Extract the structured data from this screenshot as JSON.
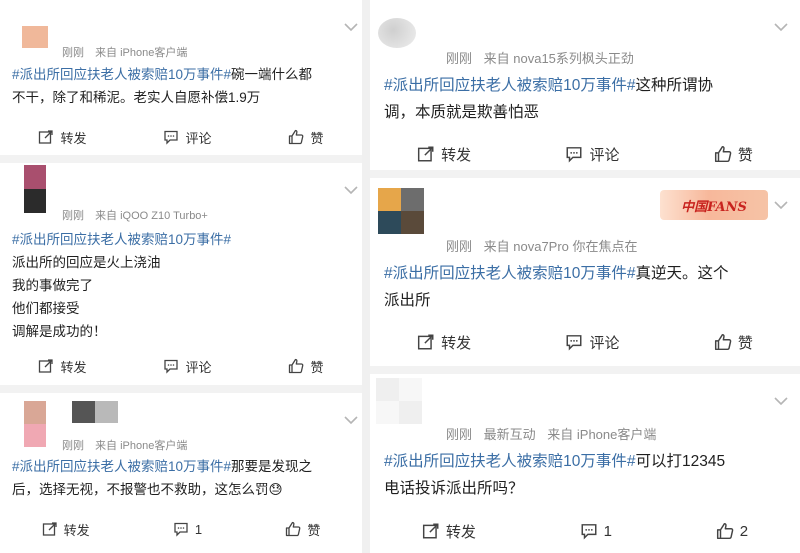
{
  "left": {
    "posts": [
      {
        "time": "刚刚",
        "source": "来自 iPhone客户端",
        "lines": [
          {
            "tag": "#派出所回应扶老人被索赔10万事件#",
            "text": "碗一端什么都"
          },
          {
            "tag": "",
            "text": "不干，除了和稀泥。老实人自愿补偿1.9万"
          }
        ],
        "actions": {
          "repost": "转发",
          "comment": "评论",
          "like": "赞"
        }
      },
      {
        "time": "刚刚",
        "source": "来自 iQOO Z10 Turbo+",
        "lines": [
          {
            "tag": "#派出所回应扶老人被索赔10万事件#",
            "text": ""
          },
          {
            "tag": "",
            "text": "派出所的回应是火上浇油"
          },
          {
            "tag": "",
            "text": "我的事做完了"
          },
          {
            "tag": "",
            "text": "他们都接受"
          },
          {
            "tag": "",
            "text": "调解是成功的！"
          }
        ],
        "actions": {
          "repost": "转发",
          "comment": "评论",
          "like": "赞"
        }
      },
      {
        "time": "刚刚",
        "source": "来自 iPhone客户端",
        "lines": [
          {
            "tag": "#派出所回应扶老人被索赔10万事件#",
            "text": "那要是发现之"
          },
          {
            "tag": "",
            "text": "后，选择无视，不报警也不救助，这怎么罚😓"
          }
        ],
        "actions": {
          "repost": "转发",
          "comment": "1",
          "like": "赞"
        }
      }
    ]
  },
  "right": {
    "posts": [
      {
        "time": "刚刚",
        "source": "来自 nova15系列枫头正劲",
        "lines": [
          {
            "tag": "#派出所回应扶老人被索赔10万事件#",
            "text": "这种所谓协"
          },
          {
            "tag": "",
            "text": "调，本质就是欺善怕恶"
          }
        ],
        "actions": {
          "repost": "转发",
          "comment": "评论",
          "like": "赞"
        }
      },
      {
        "time": "刚刚",
        "source": "来自 nova7Pro 你在焦点在",
        "badge": "中国FANS",
        "lines": [
          {
            "tag": "#派出所回应扶老人被索赔10万事件#",
            "text": "真逆天。这个"
          },
          {
            "tag": "",
            "text": "派出所"
          }
        ],
        "actions": {
          "repost": "转发",
          "comment": "评论",
          "like": "赞"
        }
      },
      {
        "time": "刚刚",
        "extra": "最新互动",
        "source": "来自 iPhone客户端",
        "lines": [
          {
            "tag": "#派出所回应扶老人被索赔10万事件#",
            "text": "可以打12345"
          },
          {
            "tag": "",
            "text": "电话投诉派出所吗？"
          }
        ],
        "actions": {
          "repost": "转发",
          "comment": "1",
          "like": "2"
        }
      }
    ]
  },
  "colors": {
    "tag": "#3b6ea5",
    "meta": "#8a8a8a",
    "separator": "#f2f2f2"
  },
  "icons": [
    "chevron-down-icon",
    "repost-icon",
    "comment-icon",
    "like-icon"
  ]
}
